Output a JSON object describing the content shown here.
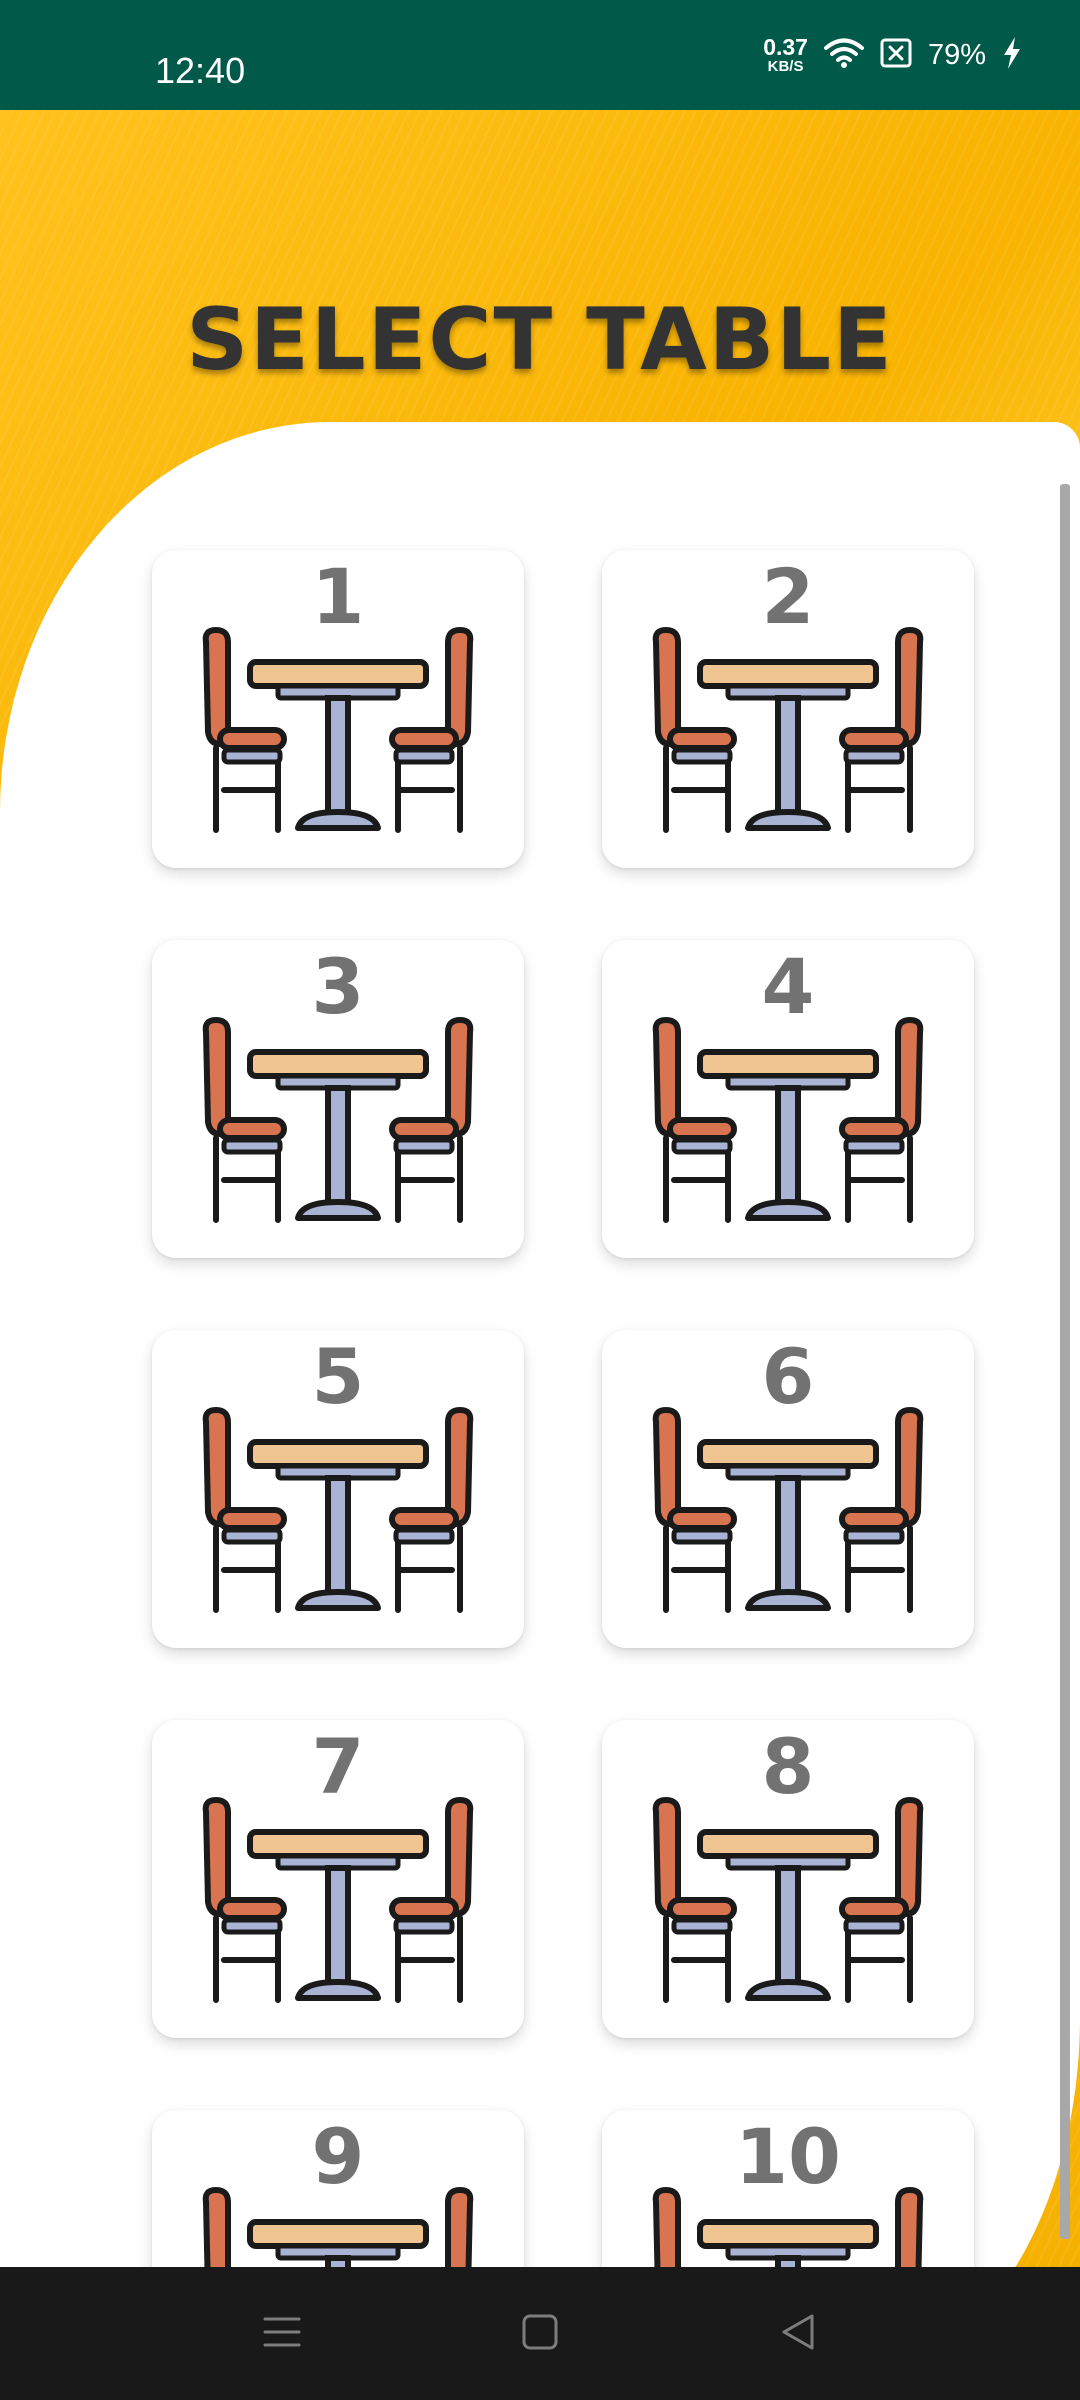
{
  "status_bar": {
    "time": "12:40",
    "net_speed_value": "0.37",
    "net_speed_unit": "KB/S",
    "battery_percent": "79%",
    "icons": [
      "wifi-icon",
      "sim-off-icon",
      "charging-icon"
    ]
  },
  "header": {
    "title": "SELECT TABLE"
  },
  "tables": [
    {
      "number": "1"
    },
    {
      "number": "2"
    },
    {
      "number": "3"
    },
    {
      "number": "4"
    },
    {
      "number": "5"
    },
    {
      "number": "6"
    },
    {
      "number": "7"
    },
    {
      "number": "8"
    },
    {
      "number": "9"
    },
    {
      "number": "10"
    }
  ],
  "nav_bar": {
    "icons": [
      "menu-icon",
      "home-icon",
      "back-icon"
    ]
  },
  "colors": {
    "status_bar_bg": "#01594a",
    "background_yellow": "#f7b500",
    "title_text": "#333333",
    "table_number": "#727272",
    "chair_orange": "#d97450",
    "tabletop_tan": "#f0c490",
    "table_leg_steel": "#a9b3d4",
    "nav_bar_bg": "#191919"
  }
}
